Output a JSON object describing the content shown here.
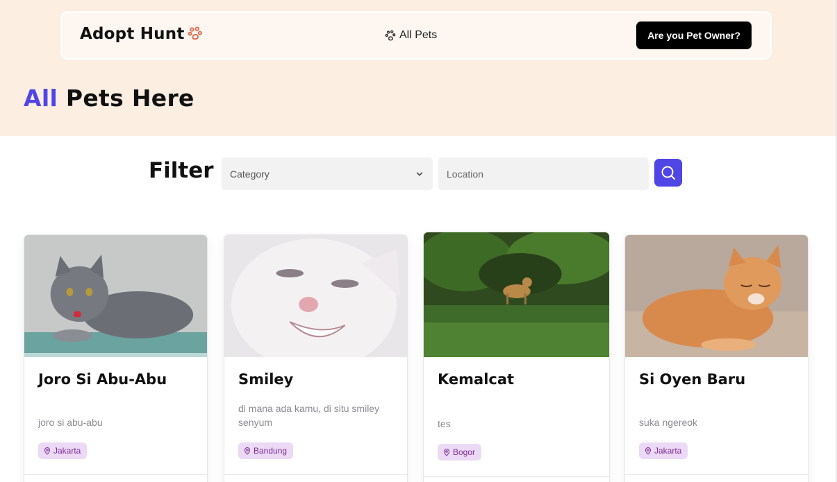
{
  "navbar": {
    "brand": "Adopt Hunt",
    "brand_icon": "paw-icon",
    "link_label": "All Pets",
    "owner_button": "Are you Pet Owner?"
  },
  "page": {
    "title_accent": "All",
    "title_rest": "Pets Here"
  },
  "filter": {
    "label": "Filter",
    "category_placeholder": "Category",
    "location_placeholder": "Location"
  },
  "colors": {
    "accent": "#4f46e5",
    "hero_bg": "#fdeee2",
    "badge_bg": "#ecd9f5",
    "badge_text": "#7b2d94",
    "paw": "#e0684a"
  },
  "pets": [
    {
      "name": "Joro Si Abu-Abu",
      "description": "joro si abu-abu",
      "location": "Jakarta"
    },
    {
      "name": "Smiley",
      "description": "di mana ada kamu, di situ smiley senyum",
      "location": "Bandung"
    },
    {
      "name": "Kemalcat",
      "description": "tes",
      "location": "Bogor"
    },
    {
      "name": "Si Oyen Baru",
      "description": "suka ngereok",
      "location": "Jakarta"
    }
  ]
}
